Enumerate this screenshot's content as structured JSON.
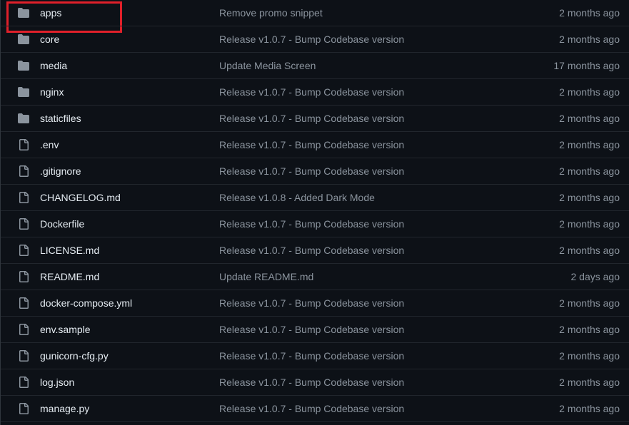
{
  "files": [
    {
      "name": "apps",
      "type": "folder",
      "icon": "folder-icon",
      "message": "Remove promo snippet",
      "age": "2 months ago"
    },
    {
      "name": "core",
      "type": "folder",
      "icon": "folder-icon",
      "message": "Release v1.0.7 - Bump Codebase version",
      "age": "2 months ago"
    },
    {
      "name": "media",
      "type": "folder",
      "icon": "folder-icon",
      "message": "Update Media Screen",
      "age": "17 months ago"
    },
    {
      "name": "nginx",
      "type": "folder",
      "icon": "folder-icon",
      "message": "Release v1.0.7 - Bump Codebase version",
      "age": "2 months ago"
    },
    {
      "name": "staticfiles",
      "type": "folder",
      "icon": "folder-icon",
      "message": "Release v1.0.7 - Bump Codebase version",
      "age": "2 months ago"
    },
    {
      "name": ".env",
      "type": "file",
      "icon": "file-icon",
      "message": "Release v1.0.7 - Bump Codebase version",
      "age": "2 months ago"
    },
    {
      "name": ".gitignore",
      "type": "file",
      "icon": "file-icon",
      "message": "Release v1.0.7 - Bump Codebase version",
      "age": "2 months ago"
    },
    {
      "name": "CHANGELOG.md",
      "type": "file",
      "icon": "file-icon",
      "message": "Release v1.0.8 - Added Dark Mode",
      "age": "2 months ago"
    },
    {
      "name": "Dockerfile",
      "type": "file",
      "icon": "file-icon",
      "message": "Release v1.0.7 - Bump Codebase version",
      "age": "2 months ago"
    },
    {
      "name": "LICENSE.md",
      "type": "file",
      "icon": "file-icon",
      "message": "Release v1.0.7 - Bump Codebase version",
      "age": "2 months ago"
    },
    {
      "name": "README.md",
      "type": "file",
      "icon": "file-icon",
      "message": "Update README.md",
      "age": "2 days ago"
    },
    {
      "name": "docker-compose.yml",
      "type": "file",
      "icon": "file-icon",
      "message": "Release v1.0.7 - Bump Codebase version",
      "age": "2 months ago"
    },
    {
      "name": "env.sample",
      "type": "file",
      "icon": "file-icon",
      "message": "Release v1.0.7 - Bump Codebase version",
      "age": "2 months ago"
    },
    {
      "name": "gunicorn-cfg.py",
      "type": "file",
      "icon": "file-icon",
      "message": "Release v1.0.7 - Bump Codebase version",
      "age": "2 months ago"
    },
    {
      "name": "log.json",
      "type": "file",
      "icon": "file-icon",
      "message": "Release v1.0.7 - Bump Codebase version",
      "age": "2 months ago"
    },
    {
      "name": "manage.py",
      "type": "file",
      "icon": "file-icon",
      "message": "Release v1.0.7 - Bump Codebase version",
      "age": "2 months ago"
    }
  ],
  "highlighted_row": "apps",
  "colors": {
    "background": "#0d1117",
    "file_name": "#e6edf3",
    "secondary_text": "#8b949e",
    "icon": "#8b949e",
    "highlight": "#e0202a"
  }
}
